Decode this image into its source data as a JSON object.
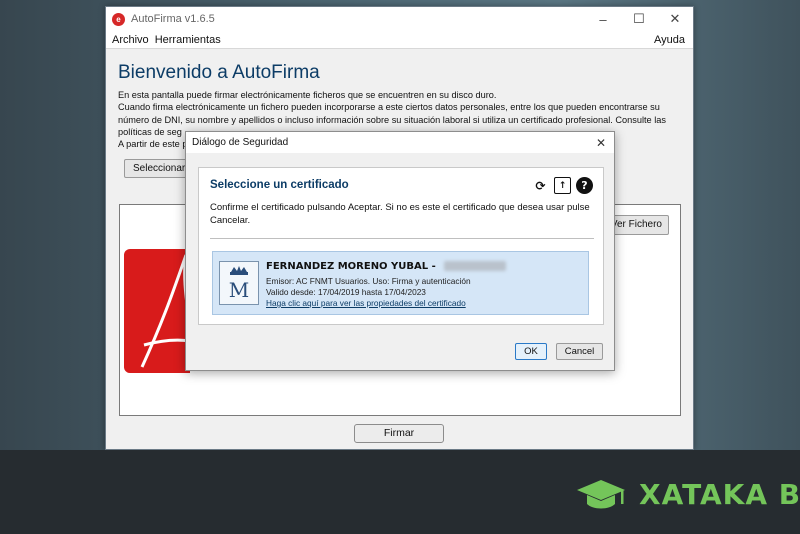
{
  "window": {
    "title": "AutoFirma v1.6.5",
    "icon": "autofirma-logo-icon"
  },
  "menu": {
    "archivo": "Archivo",
    "herramientas": "Herramientas",
    "ayuda": "Ayuda"
  },
  "main": {
    "welcome_title": "Bienvenido a AutoFirma",
    "intro_lines": [
      "En esta pantalla puede firmar electrónicamente ficheros que se encuentren en su disco duro.",
      "Cuando firma electrónicamente un fichero pueden incorporarse a este ciertos datos personales, entre los que pueden encontrarse su",
      "número de DNI, su nombre y apellidos o incluso información sobre su situación laboral si utiliza un certificado profesional. Consulte las",
      "políticas de seg",
      "A partir de este p"
    ],
    "select_file_label": "Seleccionar",
    "view_file_label": "Ver Fichero",
    "sign_label": "Firmar"
  },
  "dialog": {
    "title": "Diálogo de Seguridad",
    "close_glyph": "✕",
    "heading": "Seleccione un certificado",
    "message": "Confirme el certificado pulsando Aceptar. Si no es este el certificado que desea usar pulse Cancelar.",
    "certificate": {
      "name": "FERNANDEZ MORENO YUBAL -",
      "issuer": "Emisor: AC FNMT Usuarios. Uso: Firma y autenticación",
      "validity": "Valido desde: 17/04/2019 hasta 17/04/2023",
      "link": "Haga clic aquí para ver las propiedades del certificado"
    },
    "ok_label": "OK",
    "cancel_label": "Cancel"
  },
  "brand": {
    "text": "XATAKA BA",
    "color": "#74c55a"
  },
  "colors": {
    "heading_blue": "#0c3c66",
    "pdf_red": "#d81b1b",
    "cert_highlight": "#d5e6f7"
  }
}
